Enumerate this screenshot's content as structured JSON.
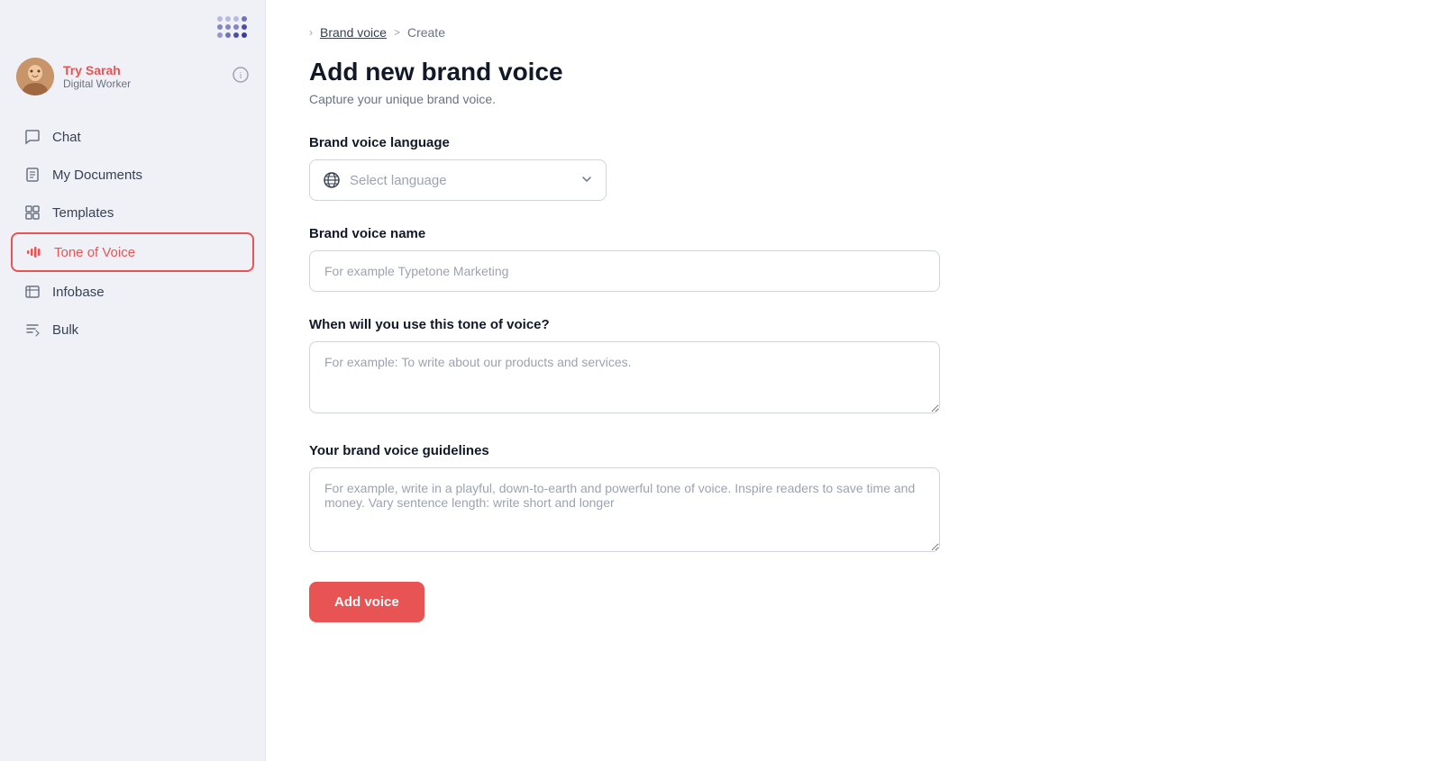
{
  "sidebar": {
    "logo_alt": "App logo dots",
    "user": {
      "name": "Try Sarah",
      "role": "Digital Worker",
      "avatar_emoji": "👩"
    },
    "info_icon": "ⓘ",
    "nav_items": [
      {
        "id": "chat",
        "label": "Chat",
        "icon": "chat"
      },
      {
        "id": "my-documents",
        "label": "My Documents",
        "icon": "documents"
      },
      {
        "id": "templates",
        "label": "Templates",
        "icon": "templates"
      },
      {
        "id": "tone-of-voice",
        "label": "Tone of Voice",
        "icon": "tone",
        "active": true
      },
      {
        "id": "infobase",
        "label": "Infobase",
        "icon": "infobase"
      },
      {
        "id": "bulk",
        "label": "Bulk",
        "icon": "bulk"
      }
    ]
  },
  "breadcrumb": {
    "parent": "Brand voice",
    "separator": ">",
    "current": "Create"
  },
  "page": {
    "title": "Add new brand voice",
    "subtitle": "Capture your unique brand voice."
  },
  "form": {
    "language_label": "Brand voice language",
    "language_placeholder": "Select language",
    "name_label": "Brand voice name",
    "name_placeholder": "For example Typetone Marketing",
    "usage_label": "When will you use this tone of voice?",
    "usage_placeholder": "For example: To write about our products and services.",
    "guidelines_label": "Your brand voice guidelines",
    "guidelines_placeholder": "For example, write in a playful, down-to-earth and powerful tone of voice. Inspire readers to save time and money. Vary sentence length: write short and longer",
    "submit_label": "Add voice"
  },
  "colors": {
    "accent": "#e85454",
    "active_border": "#e85454",
    "active_text": "#e85454"
  }
}
